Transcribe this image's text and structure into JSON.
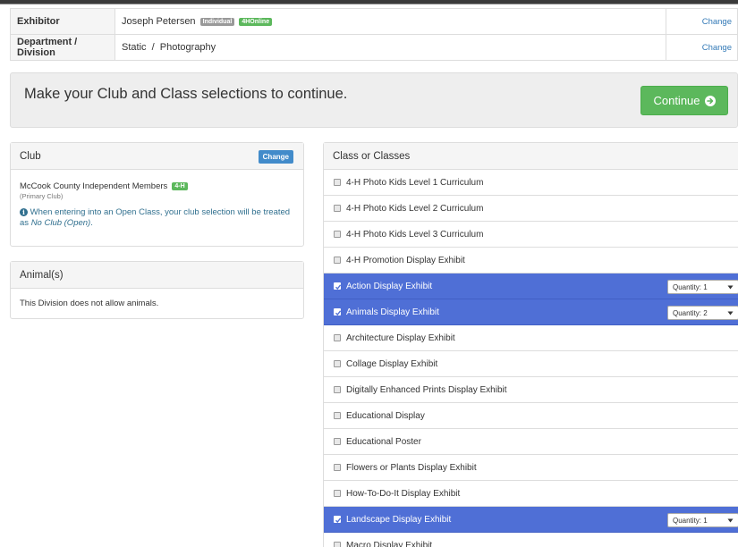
{
  "exhibitor": {
    "label": "Exhibitor",
    "name": "Joseph Petersen",
    "badges": [
      "Individual",
      "4HOnline"
    ],
    "change": "Change"
  },
  "department": {
    "label": "Department / Division",
    "value": "Static  /  Photography",
    "change": "Change"
  },
  "banner": {
    "text": "Make your Club and Class selections to continue.",
    "continue": "Continue"
  },
  "club": {
    "title": "Club",
    "change": "Change",
    "name": "McCook County Independent Members",
    "badge": "4-H",
    "primary": "(Primary Club)",
    "note_prefix": "When entering into an Open Class, your club selection will be treated as ",
    "note_em": "No Club (Open)",
    "note_suffix": "."
  },
  "animals": {
    "title": "Animal(s)",
    "text": "This Division does not allow animals."
  },
  "classes": {
    "title": "Class or Classes",
    "items": [
      {
        "label": "4-H Photo Kids Level 1 Curriculum",
        "selected": false
      },
      {
        "label": "4-H Photo Kids Level 2 Curriculum",
        "selected": false
      },
      {
        "label": "4-H Photo Kids Level 3 Curriculum",
        "selected": false
      },
      {
        "label": "4-H Promotion Display Exhibit",
        "selected": false
      },
      {
        "label": "Action Display Exhibit",
        "selected": true,
        "quantity": "Quantity: 1"
      },
      {
        "label": "Animals Display Exhibit",
        "selected": true,
        "quantity": "Quantity: 2"
      },
      {
        "label": "Architecture Display Exhibit",
        "selected": false
      },
      {
        "label": "Collage Display Exhibit",
        "selected": false
      },
      {
        "label": "Digitally Enhanced Prints Display Exhibit",
        "selected": false
      },
      {
        "label": "Educational Display",
        "selected": false
      },
      {
        "label": "Educational Poster",
        "selected": false
      },
      {
        "label": "Flowers or Plants Display Exhibit",
        "selected": false
      },
      {
        "label": "How-To-Do-It Display Exhibit",
        "selected": false
      },
      {
        "label": "Landscape Display Exhibit",
        "selected": true,
        "quantity": "Quantity: 1"
      },
      {
        "label": "Macro Display Exhibit",
        "selected": false
      }
    ]
  },
  "colors": {
    "selected_row": "#4f6fd6",
    "continue_button": "#5cb85c",
    "link": "#337ab7"
  }
}
